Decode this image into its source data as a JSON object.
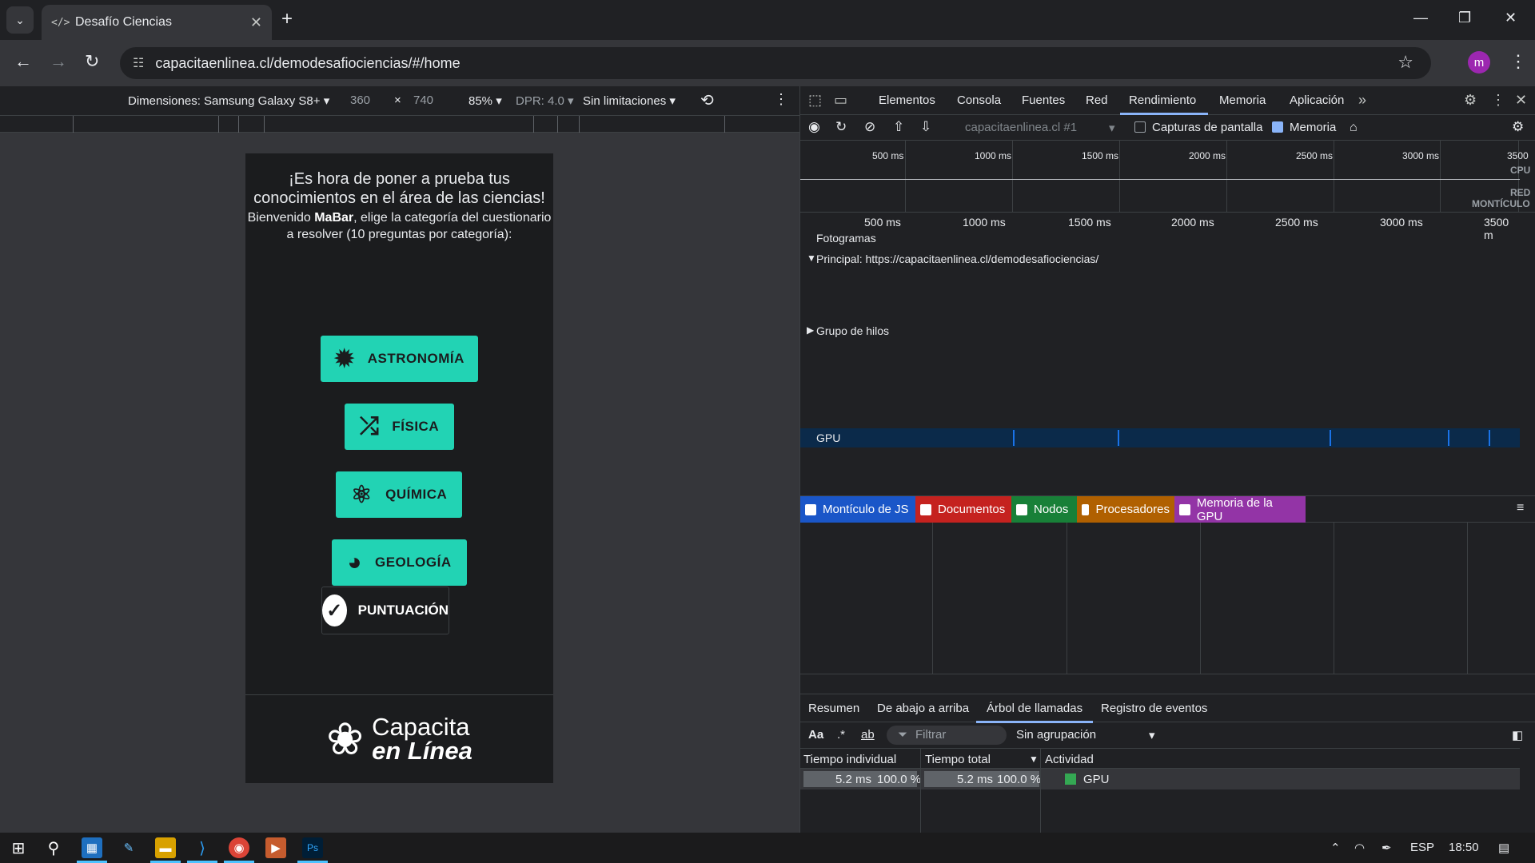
{
  "browser": {
    "tab_title": "Desafío Ciencias",
    "url": "capacitaenlinea.cl/demodesafiociencias/#/home",
    "profile_initial": "m"
  },
  "device_toolbar": {
    "dimensions_label": "Dimensiones: Samsung Galaxy S8+",
    "width": "360",
    "x": "×",
    "height": "740",
    "zoom": "85%",
    "dpr": "DPR: 4.0",
    "throttle": "Sin limitaciones"
  },
  "page": {
    "heading": "¡Es hora de poner a prueba tus conocimientos en el área de las ciencias!",
    "welcome_prefix": "Bienvenido ",
    "username": "MaBar",
    "welcome_suffix": ", elige la categoría del cuestionario a resolver (10 preguntas por categoría):",
    "categories": [
      "ASTRONOMÍA",
      "FÍSICA",
      "QUÍMICA",
      "GEOLOGÍA"
    ],
    "score_label": "PUNTUACIÓN",
    "logo_line1": "Capacita",
    "logo_line2": "en Línea",
    "accent": "#22d3b4"
  },
  "devtools": {
    "tabs": [
      "Elementos",
      "Consola",
      "Fuentes",
      "Red",
      "Rendimiento",
      "Memoria",
      "Aplicación"
    ],
    "recording_target": "capacitaenlinea.cl #1",
    "screenshots_label": "Capturas de pantalla",
    "memory_label": "Memoria",
    "overview_ticks": [
      "500 ms",
      "1000 ms",
      "1500 ms",
      "2000 ms",
      "2500 ms",
      "3000 ms",
      "3500"
    ],
    "overview_labels": {
      "cpu": "CPU",
      "net": "RED",
      "heap": "MONTÍCULO"
    },
    "ruler_ticks": [
      "500 ms",
      "1000 ms",
      "1500 ms",
      "2000 ms",
      "2500 ms",
      "3000 ms",
      "3500 m"
    ],
    "tracks": {
      "frames": "Fotogramas",
      "main": "Principal: https://capacitaenlinea.cl/demodesafiociencias/",
      "threadpool": "Grupo de hilos",
      "gpu": "GPU"
    },
    "memory_legend": [
      {
        "label": "Montículo de JS",
        "color": "#1a56c8"
      },
      {
        "label": "Documentos",
        "color": "#c5221f"
      },
      {
        "label": "Nodos",
        "color": "#188038"
      },
      {
        "label": "Procesadores",
        "color": "#b06000"
      },
      {
        "label": "Memoria de la GPU",
        "color": "#9334a6"
      }
    ],
    "bottom_tabs": [
      "Resumen",
      "De abajo a arriba",
      "Árbol de llamadas",
      "Registro de eventos"
    ],
    "filter_placeholder": "Filtrar",
    "grouping": "Sin agrupación",
    "table": {
      "headers": [
        "Tiempo individual",
        "Tiempo total",
        "Actividad"
      ],
      "row": {
        "self": "5.2 ms",
        "self_pct": "100.0 %",
        "total": "5.2 ms",
        "total_pct": "100.0 %",
        "activity": "GPU"
      }
    }
  },
  "taskbar": {
    "language": "ESP",
    "time": "18:50"
  }
}
